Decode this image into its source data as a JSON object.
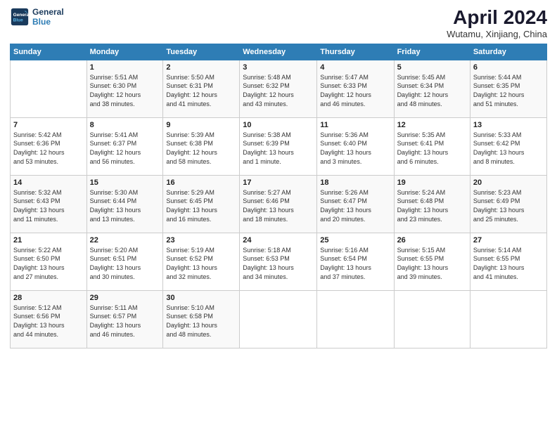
{
  "header": {
    "logo_line1": "General",
    "logo_line2": "Blue",
    "title": "April 2024",
    "subtitle": "Wutamu, Xinjiang, China"
  },
  "days_of_week": [
    "Sunday",
    "Monday",
    "Tuesday",
    "Wednesday",
    "Thursday",
    "Friday",
    "Saturday"
  ],
  "weeks": [
    [
      {
        "day": "",
        "info": ""
      },
      {
        "day": "1",
        "info": "Sunrise: 5:51 AM\nSunset: 6:30 PM\nDaylight: 12 hours\nand 38 minutes."
      },
      {
        "day": "2",
        "info": "Sunrise: 5:50 AM\nSunset: 6:31 PM\nDaylight: 12 hours\nand 41 minutes."
      },
      {
        "day": "3",
        "info": "Sunrise: 5:48 AM\nSunset: 6:32 PM\nDaylight: 12 hours\nand 43 minutes."
      },
      {
        "day": "4",
        "info": "Sunrise: 5:47 AM\nSunset: 6:33 PM\nDaylight: 12 hours\nand 46 minutes."
      },
      {
        "day": "5",
        "info": "Sunrise: 5:45 AM\nSunset: 6:34 PM\nDaylight: 12 hours\nand 48 minutes."
      },
      {
        "day": "6",
        "info": "Sunrise: 5:44 AM\nSunset: 6:35 PM\nDaylight: 12 hours\nand 51 minutes."
      }
    ],
    [
      {
        "day": "7",
        "info": "Sunrise: 5:42 AM\nSunset: 6:36 PM\nDaylight: 12 hours\nand 53 minutes."
      },
      {
        "day": "8",
        "info": "Sunrise: 5:41 AM\nSunset: 6:37 PM\nDaylight: 12 hours\nand 56 minutes."
      },
      {
        "day": "9",
        "info": "Sunrise: 5:39 AM\nSunset: 6:38 PM\nDaylight: 12 hours\nand 58 minutes."
      },
      {
        "day": "10",
        "info": "Sunrise: 5:38 AM\nSunset: 6:39 PM\nDaylight: 13 hours\nand 1 minute."
      },
      {
        "day": "11",
        "info": "Sunrise: 5:36 AM\nSunset: 6:40 PM\nDaylight: 13 hours\nand 3 minutes."
      },
      {
        "day": "12",
        "info": "Sunrise: 5:35 AM\nSunset: 6:41 PM\nDaylight: 13 hours\nand 6 minutes."
      },
      {
        "day": "13",
        "info": "Sunrise: 5:33 AM\nSunset: 6:42 PM\nDaylight: 13 hours\nand 8 minutes."
      }
    ],
    [
      {
        "day": "14",
        "info": "Sunrise: 5:32 AM\nSunset: 6:43 PM\nDaylight: 13 hours\nand 11 minutes."
      },
      {
        "day": "15",
        "info": "Sunrise: 5:30 AM\nSunset: 6:44 PM\nDaylight: 13 hours\nand 13 minutes."
      },
      {
        "day": "16",
        "info": "Sunrise: 5:29 AM\nSunset: 6:45 PM\nDaylight: 13 hours\nand 16 minutes."
      },
      {
        "day": "17",
        "info": "Sunrise: 5:27 AM\nSunset: 6:46 PM\nDaylight: 13 hours\nand 18 minutes."
      },
      {
        "day": "18",
        "info": "Sunrise: 5:26 AM\nSunset: 6:47 PM\nDaylight: 13 hours\nand 20 minutes."
      },
      {
        "day": "19",
        "info": "Sunrise: 5:24 AM\nSunset: 6:48 PM\nDaylight: 13 hours\nand 23 minutes."
      },
      {
        "day": "20",
        "info": "Sunrise: 5:23 AM\nSunset: 6:49 PM\nDaylight: 13 hours\nand 25 minutes."
      }
    ],
    [
      {
        "day": "21",
        "info": "Sunrise: 5:22 AM\nSunset: 6:50 PM\nDaylight: 13 hours\nand 27 minutes."
      },
      {
        "day": "22",
        "info": "Sunrise: 5:20 AM\nSunset: 6:51 PM\nDaylight: 13 hours\nand 30 minutes."
      },
      {
        "day": "23",
        "info": "Sunrise: 5:19 AM\nSunset: 6:52 PM\nDaylight: 13 hours\nand 32 minutes."
      },
      {
        "day": "24",
        "info": "Sunrise: 5:18 AM\nSunset: 6:53 PM\nDaylight: 13 hours\nand 34 minutes."
      },
      {
        "day": "25",
        "info": "Sunrise: 5:16 AM\nSunset: 6:54 PM\nDaylight: 13 hours\nand 37 minutes."
      },
      {
        "day": "26",
        "info": "Sunrise: 5:15 AM\nSunset: 6:55 PM\nDaylight: 13 hours\nand 39 minutes."
      },
      {
        "day": "27",
        "info": "Sunrise: 5:14 AM\nSunset: 6:55 PM\nDaylight: 13 hours\nand 41 minutes."
      }
    ],
    [
      {
        "day": "28",
        "info": "Sunrise: 5:12 AM\nSunset: 6:56 PM\nDaylight: 13 hours\nand 44 minutes."
      },
      {
        "day": "29",
        "info": "Sunrise: 5:11 AM\nSunset: 6:57 PM\nDaylight: 13 hours\nand 46 minutes."
      },
      {
        "day": "30",
        "info": "Sunrise: 5:10 AM\nSunset: 6:58 PM\nDaylight: 13 hours\nand 48 minutes."
      },
      {
        "day": "",
        "info": ""
      },
      {
        "day": "",
        "info": ""
      },
      {
        "day": "",
        "info": ""
      },
      {
        "day": "",
        "info": ""
      }
    ]
  ]
}
